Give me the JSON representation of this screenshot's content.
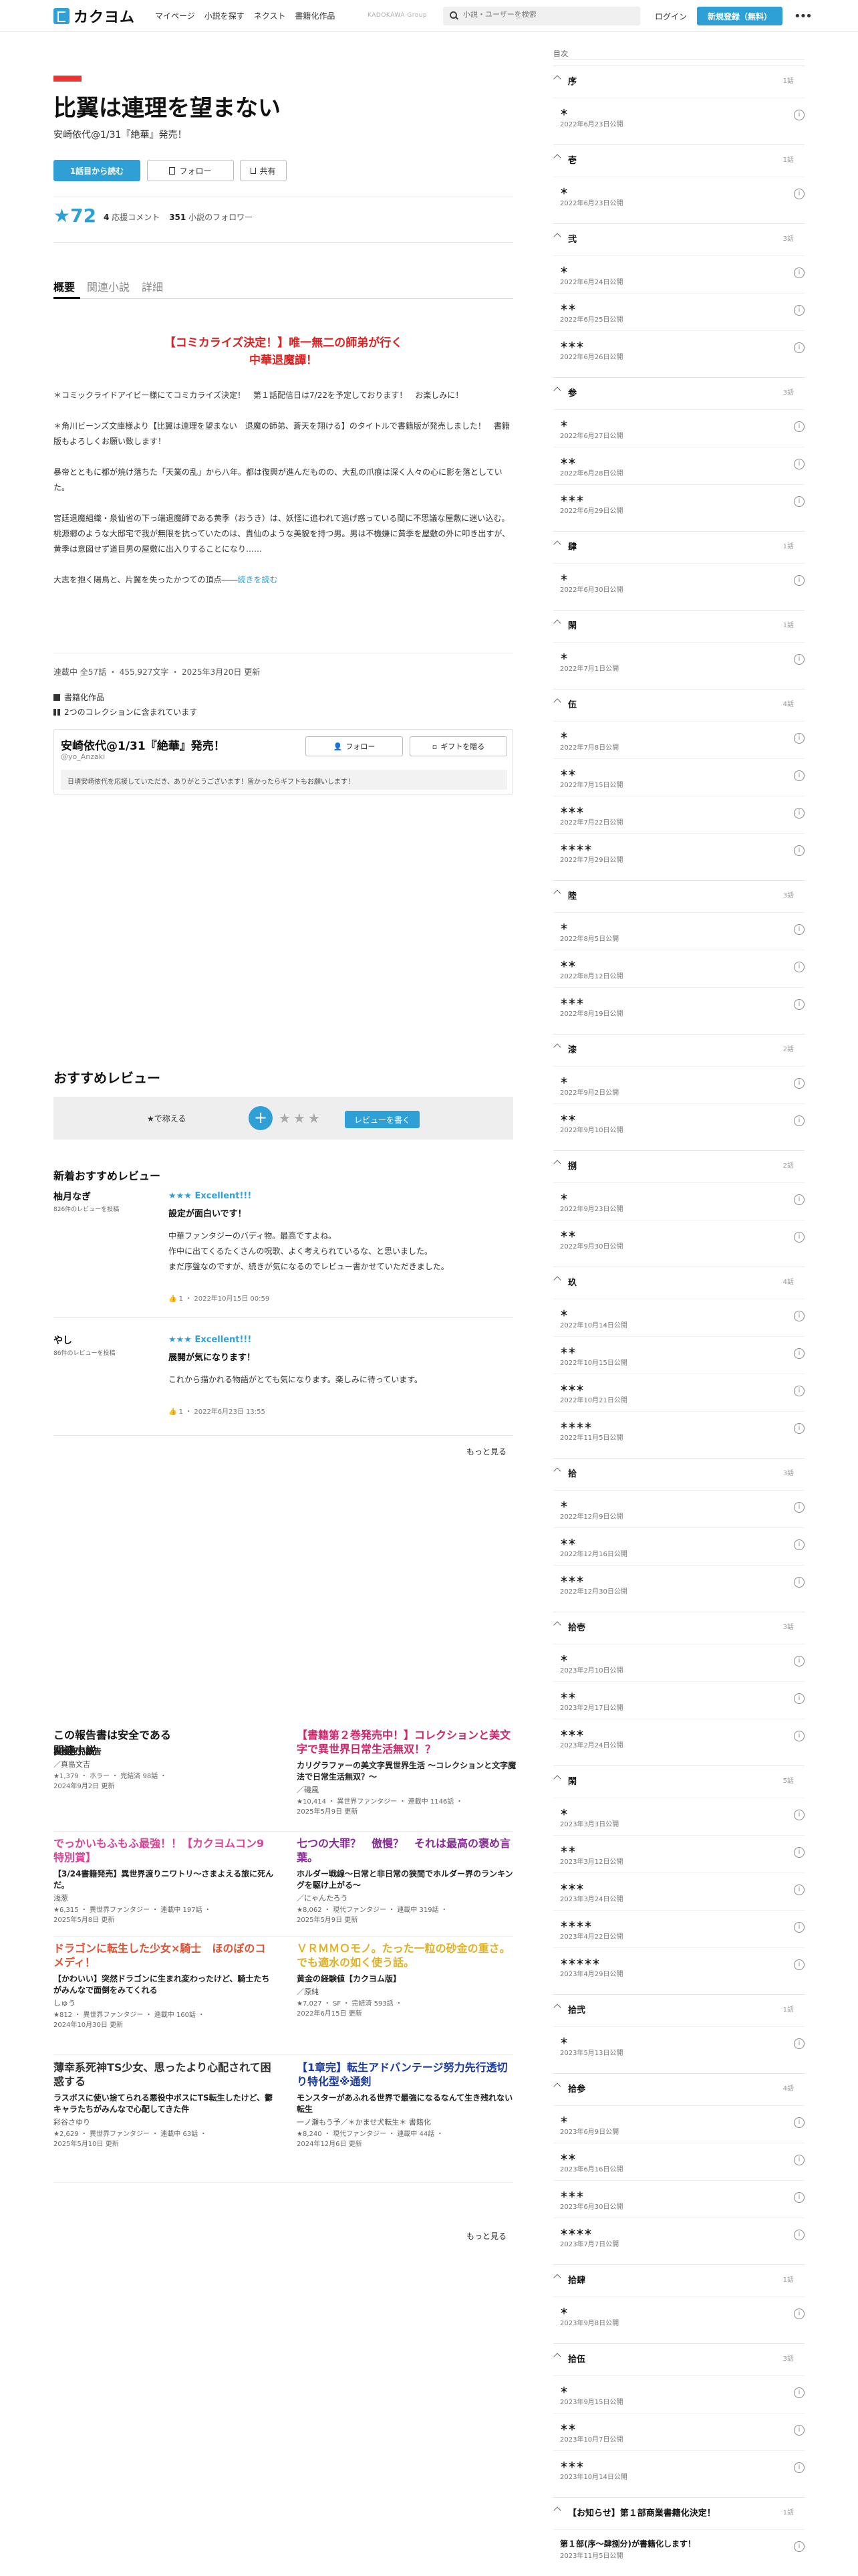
{
  "header": {
    "logo": "カクヨム",
    "nav": [
      "マイページ",
      "小説を探す",
      "ネクスト",
      "書籍化作品"
    ],
    "kadokawa": "KADOKAWA Group",
    "search_placeholder": "小説・ユーザーを検索",
    "login": "ログイン",
    "signup": "新規登録（無料）",
    "more": "•••"
  },
  "work": {
    "title": "比翼は連理を望まない",
    "author": "安崎依代@1/31『絶華』発売！",
    "read_button": "1話目から読む",
    "follow_button": "フォロー",
    "share_button": "共有",
    "stars": "★72",
    "comments_num": "4",
    "comments_label": "応援コメント",
    "followers_num": "351",
    "followers_label": "小説のフォロワー"
  },
  "tabs": [
    "概要",
    "関連小説",
    "詳細"
  ],
  "catchcopy": [
    "【コミカライズ決定！】唯一無二の師弟が行く",
    "中華退魔譚！"
  ],
  "intro": [
    "＊コミックライドアイビー様にてコミカライズ決定！　第１話配信日は7/22を予定しております！　お楽しみに！",
    "＊角川ビーンズ文庫様より【比翼は連理を望まない　退魔の師弟、蒼天を翔ける】のタイトルで書籍版が発売しました！　書籍版もよろしくお願い致します！",
    "暴帝とともに都が焼け落ちた「天業の乱」から八年。都は復興が進んだものの、大乱の爪痕は深く人々の心に影を落としていた。",
    "宮廷退魔組織・泉仙省の下っ端退魔師である黄季（おうき）は、妖怪に追われて逃げ惑っている間に不思議な屋敷に迷い込む。桃源郷のような大邸宅で我が無限を抗っていたのは、貴仙のような美貌を持つ男。男は不機嫌に黄季を屋敷の外に叩き出すが、黄季は意図せず道目男の屋敷に出入りすることになり……",
    "大志を抱く陽鳥と、片翼を失ったかつての頂点――"
  ],
  "intro_more": "続きを読む",
  "meta": "連載中 全57話 ・ 455,927文字 ・ 2025年3月20日 更新",
  "book_label": "書籍化作品",
  "coll_label": "2つのコレクションに含まれています",
  "author_box": {
    "name": "安崎依代@1/31『絶華』発売！",
    "id": "@yo_Anzaki",
    "follow": "フォロー",
    "gift": "ギフトを贈る",
    "message": "日頃安崎依代を応援していただき、ありがとうございます！皆かったらギフトもお願いします！"
  },
  "reviews": {
    "heading": "おすすめレビュー",
    "rate_label": "★で称える",
    "stars": "★★★",
    "write": "レビューを書く",
    "new_heading": "新着おすすめレビュー",
    "more": "もっと見る",
    "items": [
      {
        "user": "柚月なぎ",
        "count": "826件のレビューを投稿",
        "stars": "★★★ Excellent!!!",
        "title": "設定が面白いです！",
        "body": [
          "中華ファンタジーのバディ物。最高ですよね。",
          "作中に出てくるたくさんの呪歌、よく考えられているな、と思いました。",
          "まだ序盤なのですが、続きが気になるのでレビュー書かせていただきました。"
        ],
        "foot": "1 ・ 2022年10月15日 00:59"
      },
      {
        "user": "やし",
        "count": "86件のレビューを投稿",
        "stars": "★★★ Excellent!!!",
        "title": "展開が気になります！",
        "body": [
          "これから描かれる物語がとても気になります。楽しみに待っています。"
        ],
        "foot": "1 ・ 2022年6月23日 13:55"
      }
    ]
  },
  "related": {
    "heading": "関連小説",
    "more": "もっと見る",
    "items": [
      {
        "title": "この報告書は安全である",
        "color": "#111",
        "sub": "右園死児報告",
        "author": "／真島文吉",
        "meta": [
          "★1,379 ・ ホラー ・ 完結済 98話 ・",
          "2024年9月2日 更新"
        ]
      },
      {
        "title": "【書籍第２巻発売中！】コレクションと美文字で異世界日常生活無双！？",
        "color": "#d2246a",
        "sub": "カリグラファーの美文字異世界生活 〜コレクションと文字魔法で日常生活無双？〜",
        "author": "／磯風",
        "meta": [
          "★10,414 ・ 異世界ファンタジー ・ 連載中 1146話 ・",
          "2025年5月9日 更新"
        ]
      },
      {
        "title": "でっかいもふもふ最強！！【カクヨムコン9特別賞】",
        "color": "#e0409a",
        "sub": "【3/24書籍発売】異世界渡りニワトリ〜さまよえる旅に死んだ。",
        "author": "浅葱",
        "meta": [
          "★6,315 ・ 異世界ファンタジー ・ 連載中 197話 ・",
          "2025年5月8日 更新"
        ]
      },
      {
        "title": "七つの大罪？　傲慢？　それは最高の褒め言葉。",
        "color": "#8a2a9a",
        "sub": "ホルダー戦線〜日常と非日常の狭間でホルダー界のランキングを駆け上がる〜",
        "author": "／にゃんたろう",
        "meta": [
          "★8,062 ・ 現代ファンタジー ・ 連載中 319話 ・",
          "2025年5月9日 更新"
        ]
      },
      {
        "title": "ドラゴンに転生した少女×騎士　ほのぼのコメディ！",
        "color": "#e05030",
        "sub": "【かわいい】突然ドラゴンに生まれ変わったけど、騎士たちがみんなで面倒をみてくれる",
        "author": "しゅう",
        "meta": [
          "★812 ・ 異世界ファンタジー ・ 連載中 160話 ・",
          "2024年10月30日 更新"
        ]
      },
      {
        "title": "ＶＲＭＭＯモノ。たった一粒の砂金の重さ。でも適水の如く使う話。",
        "color": "#e0b020",
        "sub": "黄金の経験値【カクヨム版】",
        "author": "／原純",
        "meta": [
          "★7,027 ・ SF ・ 完結済 593話 ・",
          "2022年6月15日 更新"
        ]
      },
      {
        "title": "薄幸系死神TS少女、思ったより心配されて困惑する",
        "color": "#333",
        "sub": "ラスボスに使い捨てられる悪役中ボスにTS転生したけど、鬱キャラたちがみんなで心配してきた件",
        "author": "彩谷さゆり",
        "meta": [
          "★2,629 ・ 異世界ファンタジー ・ 連載中 63話 ・",
          "2025年5月10日 更新"
        ]
      },
      {
        "title": "【1章完】転生アドバンテージ努力先行透切り特化型※通剣",
        "color": "#1a3aa0",
        "sub": "モンスターがあふれる世界で最強になるなんて生き残れない転生",
        "author": "一ノ瀬もう予／＊かませ犬転生＊ 書籍化",
        "meta": [
          "★8,240 ・ 現代ファンタジー ・ 連載中 44話 ・",
          "2024年12月6日 更新"
        ]
      }
    ]
  },
  "toc": {
    "label": "目次",
    "chapters": [
      {
        "name": "序",
        "count": "1話",
        "eps": [
          {
            "t": "＊",
            "d": "2022年6月23日公開"
          }
        ]
      },
      {
        "name": "壱",
        "count": "1話",
        "eps": [
          {
            "t": "＊",
            "d": "2022年6月23日公開"
          }
        ]
      },
      {
        "name": "弐",
        "count": "3話",
        "eps": [
          {
            "t": "＊",
            "d": "2022年6月24日公開"
          },
          {
            "t": "＊＊",
            "d": "2022年6月25日公開"
          },
          {
            "t": "＊＊＊",
            "d": "2022年6月26日公開"
          }
        ]
      },
      {
        "name": "参",
        "count": "3話",
        "eps": [
          {
            "t": "＊",
            "d": "2022年6月27日公開"
          },
          {
            "t": "＊＊",
            "d": "2022年6月28日公開"
          },
          {
            "t": "＊＊＊",
            "d": "2022年6月29日公開"
          }
        ]
      },
      {
        "name": "肆",
        "count": "1話",
        "eps": [
          {
            "t": "＊",
            "d": "2022年6月30日公開"
          }
        ]
      },
      {
        "name": "閑",
        "count": "1話",
        "eps": [
          {
            "t": "＊",
            "d": "2022年7月1日公開"
          }
        ]
      },
      {
        "name": "伍",
        "count": "4話",
        "eps": [
          {
            "t": "＊",
            "d": "2022年7月8日公開"
          },
          {
            "t": "＊＊",
            "d": "2022年7月15日公開"
          },
          {
            "t": "＊＊＊",
            "d": "2022年7月22日公開"
          },
          {
            "t": "＊＊＊＊",
            "d": "2022年7月29日公開"
          }
        ]
      },
      {
        "name": "陸",
        "count": "3話",
        "eps": [
          {
            "t": "＊",
            "d": "2022年8月5日公開"
          },
          {
            "t": "＊＊",
            "d": "2022年8月12日公開"
          },
          {
            "t": "＊＊＊",
            "d": "2022年8月19日公開"
          }
        ]
      },
      {
        "name": "漆",
        "count": "2話",
        "eps": [
          {
            "t": "＊",
            "d": "2022年9月2日公開"
          },
          {
            "t": "＊＊",
            "d": "2022年9月10日公開"
          }
        ]
      },
      {
        "name": "捌",
        "count": "2話",
        "eps": [
          {
            "t": "＊",
            "d": "2022年9月23日公開"
          },
          {
            "t": "＊＊",
            "d": "2022年9月30日公開"
          }
        ]
      },
      {
        "name": "玖",
        "count": "4話",
        "eps": [
          {
            "t": "＊",
            "d": "2022年10月14日公開"
          },
          {
            "t": "＊＊",
            "d": "2022年10月15日公開"
          },
          {
            "t": "＊＊＊",
            "d": "2022年10月21日公開"
          },
          {
            "t": "＊＊＊＊",
            "d": "2022年11月5日公開"
          }
        ]
      },
      {
        "name": "拾",
        "count": "3話",
        "eps": [
          {
            "t": "＊",
            "d": "2022年12月9日公開"
          },
          {
            "t": "＊＊",
            "d": "2022年12月16日公開"
          },
          {
            "t": "＊＊＊",
            "d": "2022年12月30日公開"
          }
        ]
      },
      {
        "name": "拾壱",
        "count": "3話",
        "eps": [
          {
            "t": "＊",
            "d": "2023年2月10日公開"
          },
          {
            "t": "＊＊",
            "d": "2023年2月17日公開"
          },
          {
            "t": "＊＊＊",
            "d": "2023年2月24日公開"
          }
        ]
      },
      {
        "name": "閑",
        "count": "5話",
        "eps": [
          {
            "t": "＊",
            "d": "2023年3月3日公開"
          },
          {
            "t": "＊＊",
            "d": "2023年3月12日公開"
          },
          {
            "t": "＊＊＊",
            "d": "2023年3月24日公開"
          },
          {
            "t": "＊＊＊＊",
            "d": "2023年4月22日公開"
          },
          {
            "t": "＊＊＊＊＊",
            "d": "2023年4月29日公開"
          }
        ]
      },
      {
        "name": "拾弐",
        "count": "1話",
        "eps": [
          {
            "t": "＊",
            "d": "2023年5月13日公開"
          }
        ]
      },
      {
        "name": "拾参",
        "count": "4話",
        "eps": [
          {
            "t": "＊",
            "d": "2023年6月9日公開"
          },
          {
            "t": "＊＊",
            "d": "2023年6月16日公開"
          },
          {
            "t": "＊＊＊",
            "d": "2023年6月30日公開"
          },
          {
            "t": "＊＊＊＊",
            "d": "2023年7月7日公開"
          }
        ]
      },
      {
        "name": "拾肆",
        "count": "1話",
        "eps": [
          {
            "t": "＊",
            "d": "2023年9月8日公開"
          }
        ]
      },
      {
        "name": "拾伍",
        "count": "3話",
        "eps": [
          {
            "t": "＊",
            "d": "2023年9月15日公開"
          },
          {
            "t": "＊＊",
            "d": "2023年10月7日公開"
          },
          {
            "t": "＊＊＊",
            "d": "2023年10月14日公開"
          }
        ]
      },
      {
        "name": "【お知らせ】第１部商業書籍化決定！",
        "count": "1話",
        "eps": [
          {
            "t": "第１部(序〜肆捌分)が書籍化します！",
            "d": "2023年11月5日公開"
          }
        ]
      }
    ]
  }
}
